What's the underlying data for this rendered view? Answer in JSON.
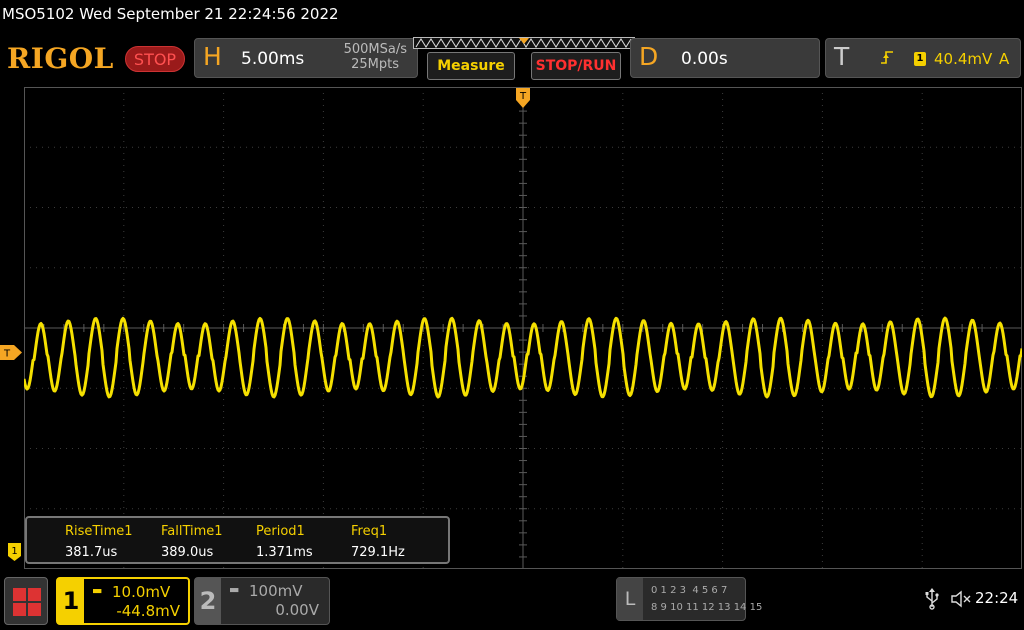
{
  "system": {
    "model": "MSO5102",
    "datetime": "Wed September 21 22:24:56 2022"
  },
  "brand": {
    "logo": "RIGOL",
    "run_state": "STOP"
  },
  "horizontal": {
    "letter": "H",
    "timebase": "5.00ms",
    "sample_rate": "500MSa/s",
    "memory_depth": "25Mpts"
  },
  "buttons": {
    "measure": "Measure",
    "stop_run": "STOP/RUN"
  },
  "delay": {
    "letter": "D",
    "value": "0.00s"
  },
  "trigger": {
    "letter": "T",
    "edge_icon": "rising-edge-icon",
    "source": "1",
    "level": "40.4mV",
    "mode": "A"
  },
  "markers": {
    "trigger_position": "T",
    "channel_offset": "T",
    "level_channel": "1"
  },
  "measurements": [
    {
      "name": "RiseTime1",
      "value": "381.7us"
    },
    {
      "name": "FallTime1",
      "value": "389.0us"
    },
    {
      "name": "Period1",
      "value": "1.371ms"
    },
    {
      "name": "Freq1",
      "value": "729.1Hz"
    }
  ],
  "channels": [
    {
      "number": "1",
      "scale": "10.0mV",
      "offset": "-44.8mV",
      "color": "#f5d000",
      "active": true
    },
    {
      "number": "2",
      "scale": "100mV",
      "offset": "0.00V",
      "color": "#aaaaaa",
      "active": false
    }
  ],
  "logic": {
    "letter": "L",
    "row1": "0 1 2 3  4 5 6 7",
    "row2": "8 9 10 11 12 13 14 15"
  },
  "status": {
    "clock": "22:24",
    "usb_icon": "usb-icon",
    "speaker_icon": "speaker-muted-icon"
  },
  "trace": {
    "color": "#f5e000",
    "signal": "periodic waveform ~729.1Hz with slow beat envelope"
  }
}
